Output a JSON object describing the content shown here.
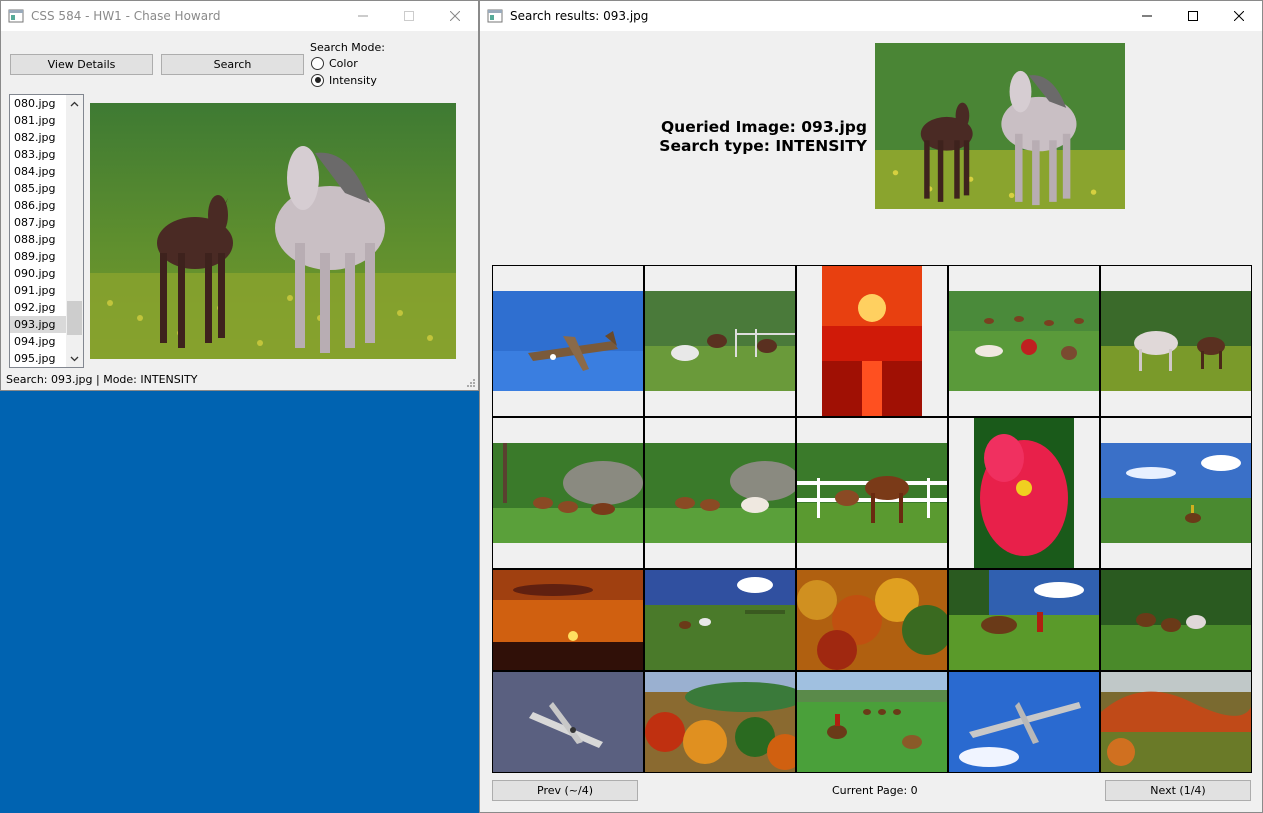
{
  "main_window": {
    "title": "CSS 584 - HW1 - Chase Howard",
    "view_details_label": "View Details",
    "search_label": "Search",
    "search_mode_label": "Search Mode:",
    "mode_options": [
      {
        "label": "Color",
        "checked": false
      },
      {
        "label": "Intensity",
        "checked": true
      }
    ],
    "file_list": [
      "080.jpg",
      "081.jpg",
      "082.jpg",
      "083.jpg",
      "084.jpg",
      "085.jpg",
      "086.jpg",
      "087.jpg",
      "088.jpg",
      "089.jpg",
      "090.jpg",
      "091.jpg",
      "092.jpg",
      "093.jpg",
      "094.jpg",
      "095.jpg"
    ],
    "selected_file": "093.jpg",
    "status_text": "Search: 093.jpg | Mode: INTENSITY"
  },
  "results_window": {
    "title": "Search results: 093.jpg",
    "queried_image_text": "Queried Image: 093.jpg",
    "search_type_text": "Search type: INTENSITY",
    "prev_label": "Prev (~/4)",
    "current_page_label": "Current Page: 0",
    "next_label": "Next (1/4)",
    "results": [
      {
        "subject": "plane-blue-sky"
      },
      {
        "subject": "horses-fence"
      },
      {
        "subject": "red-sunset"
      },
      {
        "subject": "cows-field"
      },
      {
        "subject": "horses-grazing"
      },
      {
        "subject": "horses-rocks"
      },
      {
        "subject": "horses-rocks-white"
      },
      {
        "subject": "horses-white-fence"
      },
      {
        "subject": "pink-flower"
      },
      {
        "subject": "rider-plain"
      },
      {
        "subject": "orange-sunset"
      },
      {
        "subject": "riders-field"
      },
      {
        "subject": "autumn-trees"
      },
      {
        "subject": "horse-rider"
      },
      {
        "subject": "horses-meadow"
      },
      {
        "subject": "plane-gray-sky"
      },
      {
        "subject": "autumn-hills"
      },
      {
        "subject": "riders-green"
      },
      {
        "subject": "jet-blue-sky"
      },
      {
        "subject": "red-hills"
      }
    ]
  },
  "colors": {
    "desktop": "#0063b1",
    "window_bg": "#f0f0f0",
    "button_bg": "#e1e1e1",
    "grass": "#6a9a2c",
    "flowers": "#c8c83a"
  }
}
